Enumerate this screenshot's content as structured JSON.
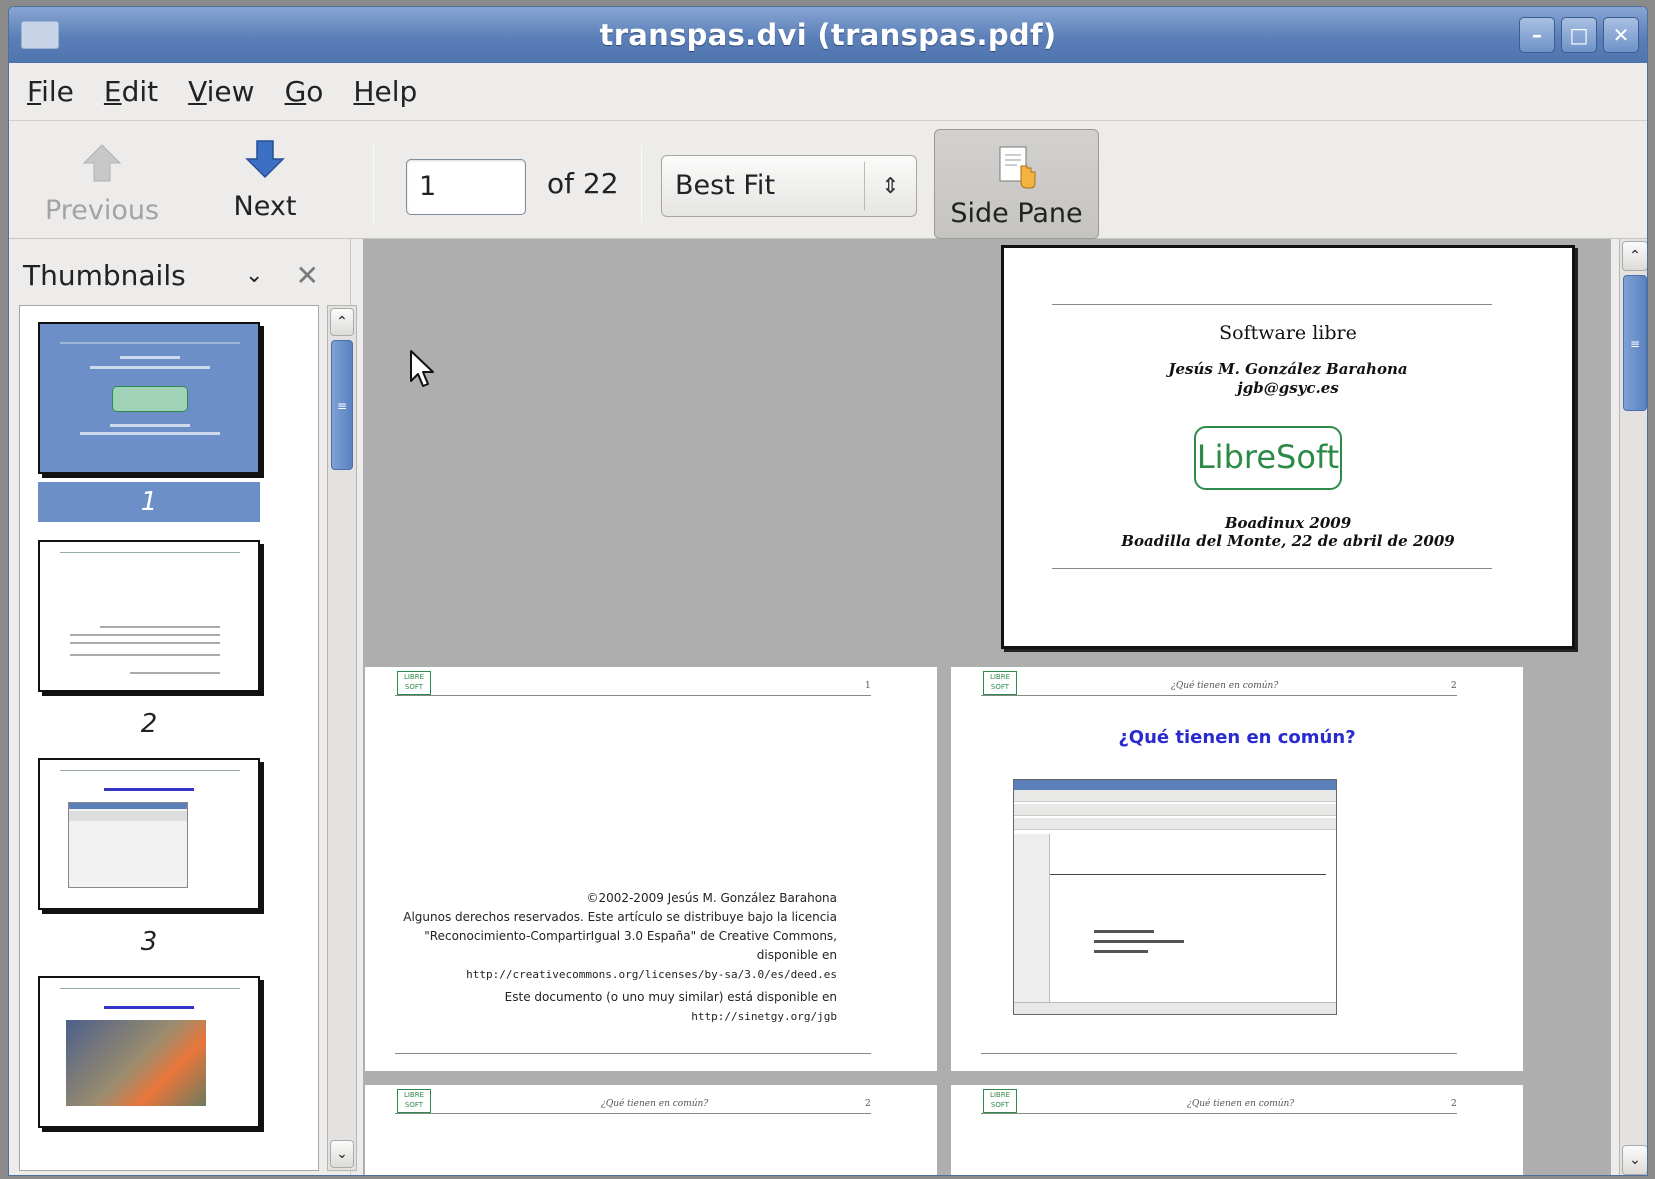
{
  "window": {
    "title": "transpas.dvi (transpas.pdf)",
    "controls": [
      "minimize",
      "maximize",
      "close"
    ]
  },
  "menu": [
    {
      "mnemonic": "F",
      "rest": "ile"
    },
    {
      "mnemonic": "E",
      "rest": "dit"
    },
    {
      "mnemonic": "V",
      "rest": "iew"
    },
    {
      "mnemonic": "G",
      "rest": "o"
    },
    {
      "mnemonic": "H",
      "rest": "elp"
    }
  ],
  "toolbar": {
    "previous_label": "Previous",
    "next_label": "Next",
    "page_value": "1",
    "of_label": "of 22",
    "zoom_value": "Best Fit",
    "side_pane_label": "Side Pane"
  },
  "sidebar": {
    "title": "Thumbnails",
    "thumbnails": [
      {
        "number": "1",
        "selected": true
      },
      {
        "number": "2",
        "selected": false
      },
      {
        "number": "3",
        "selected": false
      },
      {
        "number": "",
        "selected": false
      }
    ]
  },
  "document": {
    "page1": {
      "title": "Software libre",
      "author": "Jesús M. González Barahona",
      "email": "jgb@gsyc.es",
      "logo": "LibreSoft",
      "event": "Boadinux 2009",
      "place_date": "Boadilla del Monte, 22 de abril de 2009"
    },
    "page2": {
      "page_number": "1",
      "copyright": "©2002-2009 Jesús M. González Barahona",
      "license_line1": "Algunos derechos reservados. Este artículo se distribuye bajo la licencia",
      "license_line2": "\"Reconocimiento-CompartirIgual 3.0 España\" de Creative Commons,",
      "license_line3": "disponible en",
      "license_url": "http://creativecommons.org/licenses/by-sa/3.0/es/deed.es",
      "availability": "Este documento (o uno muy similar) está disponible en",
      "availability_url": "http://sinetgy.org/jgb"
    },
    "page3": {
      "header": "¿Qué tienen en común?",
      "page_number": "2",
      "heading": "¿Qué tienen en común?"
    },
    "page4": {
      "header": "¿Qué tienen en común?",
      "page_number": "2"
    },
    "page5": {
      "header": "¿Qué tienen en común?",
      "page_number": "2"
    }
  }
}
